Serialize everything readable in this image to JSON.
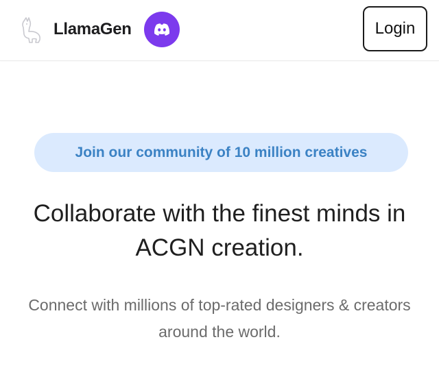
{
  "header": {
    "brand_name": "LlamaGen",
    "logo_icon": "llama-outline-icon",
    "discord_icon": "discord-icon",
    "discord_color": "#7c3aed",
    "login_label": "Login"
  },
  "hero": {
    "pill_text": "Join our community of 10 million creatives",
    "pill_background": "#dbeafe",
    "pill_text_color": "#3b82c4",
    "headline": "Collaborate with the finest minds in ACGN creation.",
    "subtext": "Connect with millions of top-rated designers & creators around the world."
  }
}
